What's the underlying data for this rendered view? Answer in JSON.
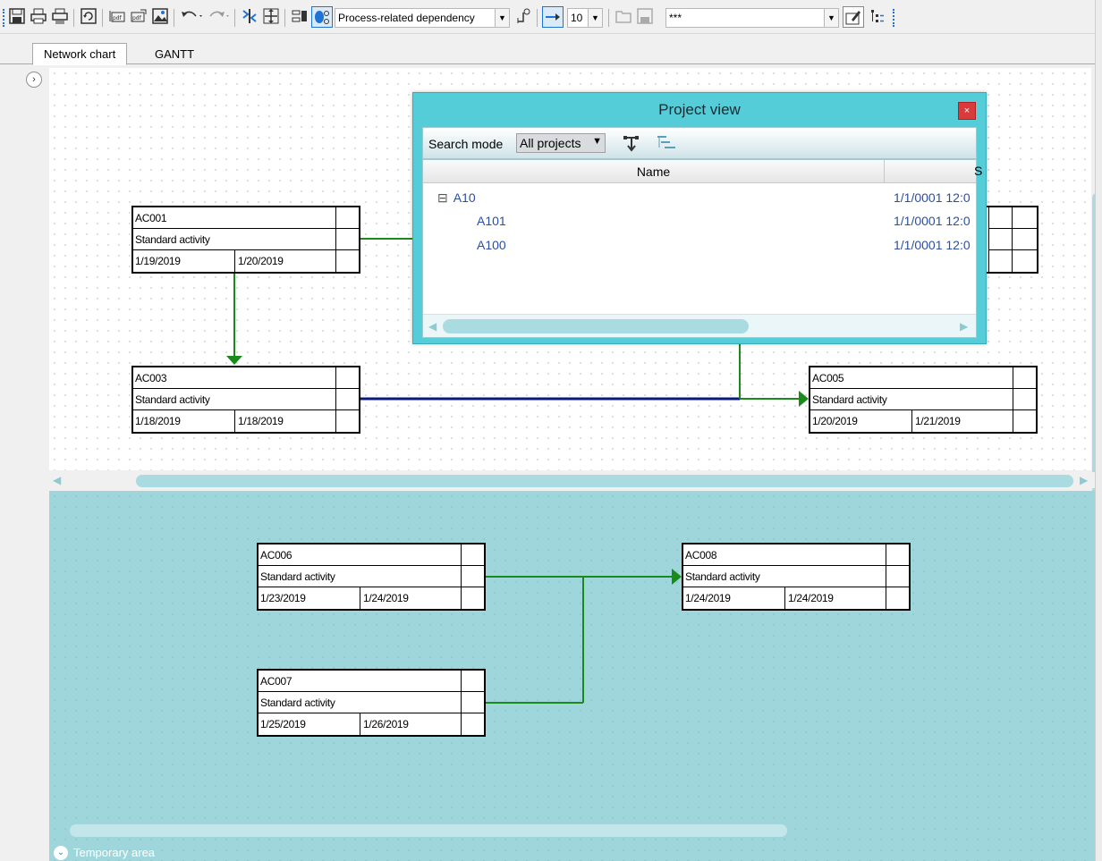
{
  "toolbar": {
    "dependency_select": "Process-related dependency",
    "level_select": "10",
    "filter_select": "***",
    "icons": [
      "save-icon",
      "print-icon",
      "print-preview-icon",
      "refresh-icon",
      "import-icon",
      "export-icon",
      "image-icon",
      "undo-icon",
      "redo-icon",
      "collapse-icon",
      "expand-icon",
      "layout-icon",
      "dependency-mode-icon",
      "link-icon",
      "arrow-icon",
      "open-icon",
      "save-layout-icon",
      "edit-icon",
      "tree-icon"
    ]
  },
  "tabs": [
    {
      "label": "Network chart",
      "active": true
    },
    {
      "label": "GANTT",
      "active": false
    }
  ],
  "activities_top": [
    {
      "id": "AC001",
      "type": "Standard activity",
      "start": "1/19/2019",
      "end": "1/20/2019"
    },
    {
      "id": "AC003",
      "type": "Standard activity",
      "start": "1/18/2019",
      "end": "1/18/2019"
    },
    {
      "id": "AC005",
      "type": "Standard activity",
      "start": "1/20/2019",
      "end": "1/21/2019"
    }
  ],
  "activities_bottom": [
    {
      "id": "AC006",
      "type": "Standard activity",
      "start": "1/23/2019",
      "end": "1/24/2019"
    },
    {
      "id": "AC008",
      "type": "Standard activity",
      "start": "1/24/2019",
      "end": "1/24/2019"
    },
    {
      "id": "AC007",
      "type": "Standard activity",
      "start": "1/25/2019",
      "end": "1/26/2019"
    }
  ],
  "project_view": {
    "title": "Project view",
    "close": "×",
    "search_mode_label": "Search mode",
    "search_mode_value": "All projects",
    "columns": [
      "Name",
      "S"
    ],
    "rows": [
      {
        "toggle": "⊟",
        "name": "A10",
        "date": "1/1/0001 12:0"
      },
      {
        "toggle": "",
        "name": "A101",
        "date": "1/1/0001 12:0"
      },
      {
        "toggle": "",
        "name": "A100",
        "date": "1/1/0001 12:0"
      }
    ]
  },
  "temporary_area": {
    "label": "Temporary area"
  },
  "colors": {
    "accent": "#55cdd9",
    "link_green": "#1a8a1a",
    "link_navy": "#0a1a7a",
    "temp_area": "#9fd6dc"
  }
}
